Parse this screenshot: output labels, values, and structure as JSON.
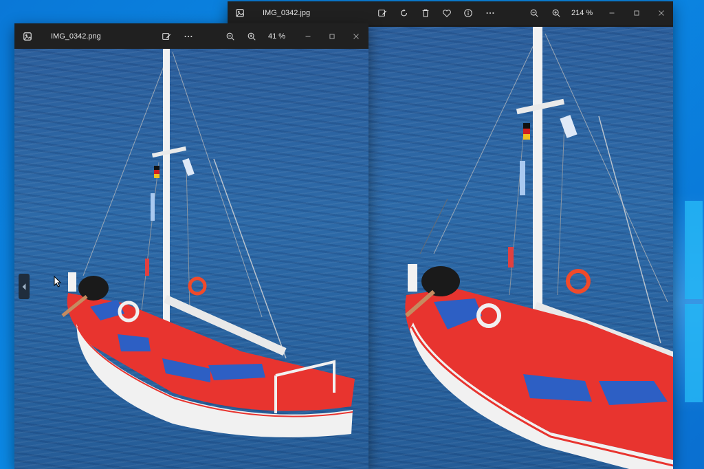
{
  "desktop": {
    "accent": "#0a78d7"
  },
  "window_left": {
    "filename": "IMG_0342.png",
    "zoom": "41 %",
    "icons": {
      "app": "photos-app-icon",
      "edit": "edit-image-icon",
      "more": "more-options-icon",
      "zoom_out": "zoom-out-icon",
      "zoom_in": "zoom-in-icon",
      "minimize": "minimize-icon",
      "maximize": "maximize-icon",
      "close": "close-icon"
    }
  },
  "window_right": {
    "filename": "IMG_0342.jpg",
    "zoom": "214 %",
    "icons": {
      "app": "photos-app-icon",
      "edit": "edit-image-icon",
      "rotate": "rotate-icon",
      "delete": "delete-icon",
      "favorite": "heart-icon",
      "info": "info-icon",
      "more": "more-options-icon",
      "zoom_out": "zoom-out-icon",
      "zoom_in": "zoom-in-icon",
      "minimize": "minimize-icon",
      "maximize": "maximize-icon",
      "close": "close-icon"
    }
  },
  "photo": {
    "subject": "red-sailboat",
    "hull_color": "#e8342f",
    "sea_color": "#2d6aa8"
  }
}
